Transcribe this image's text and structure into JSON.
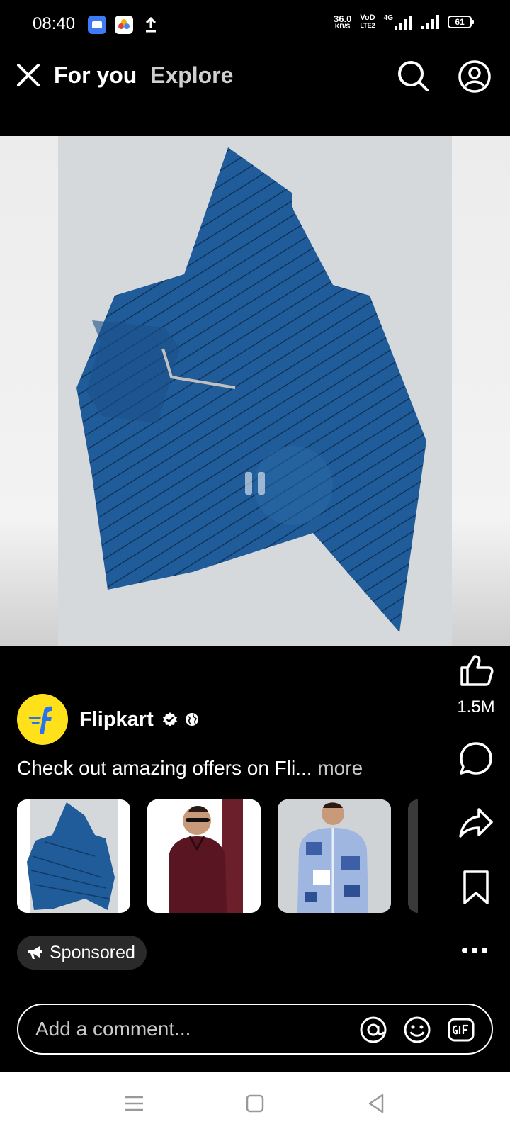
{
  "status_bar": {
    "time": "08:40",
    "net_speed_value": "36.0",
    "net_speed_unit": "KB/S",
    "volte_top": "VoD",
    "volte_bottom": "LTE2",
    "network": "4G",
    "battery": "61"
  },
  "header": {
    "tab_active": "For you",
    "tab_inactive": "Explore"
  },
  "post": {
    "author": "Flipkart",
    "caption": "Check out amazing offers on Fli...",
    "caption_more": "more",
    "like_count": "1.5M",
    "sponsored_label": "Sponsored"
  },
  "products": [
    {
      "name": "blue-striped-tshirt"
    },
    {
      "name": "maroon-shirt"
    },
    {
      "name": "blue-patterned-shirt"
    },
    {
      "name": "dark-item"
    }
  ],
  "comment": {
    "placeholder": "Add a comment..."
  },
  "colors": {
    "background": "#000000",
    "flipkart_yellow": "#ffe11b",
    "flipkart_blue": "#2874f0",
    "shirt_blue": "#1d5a96"
  }
}
